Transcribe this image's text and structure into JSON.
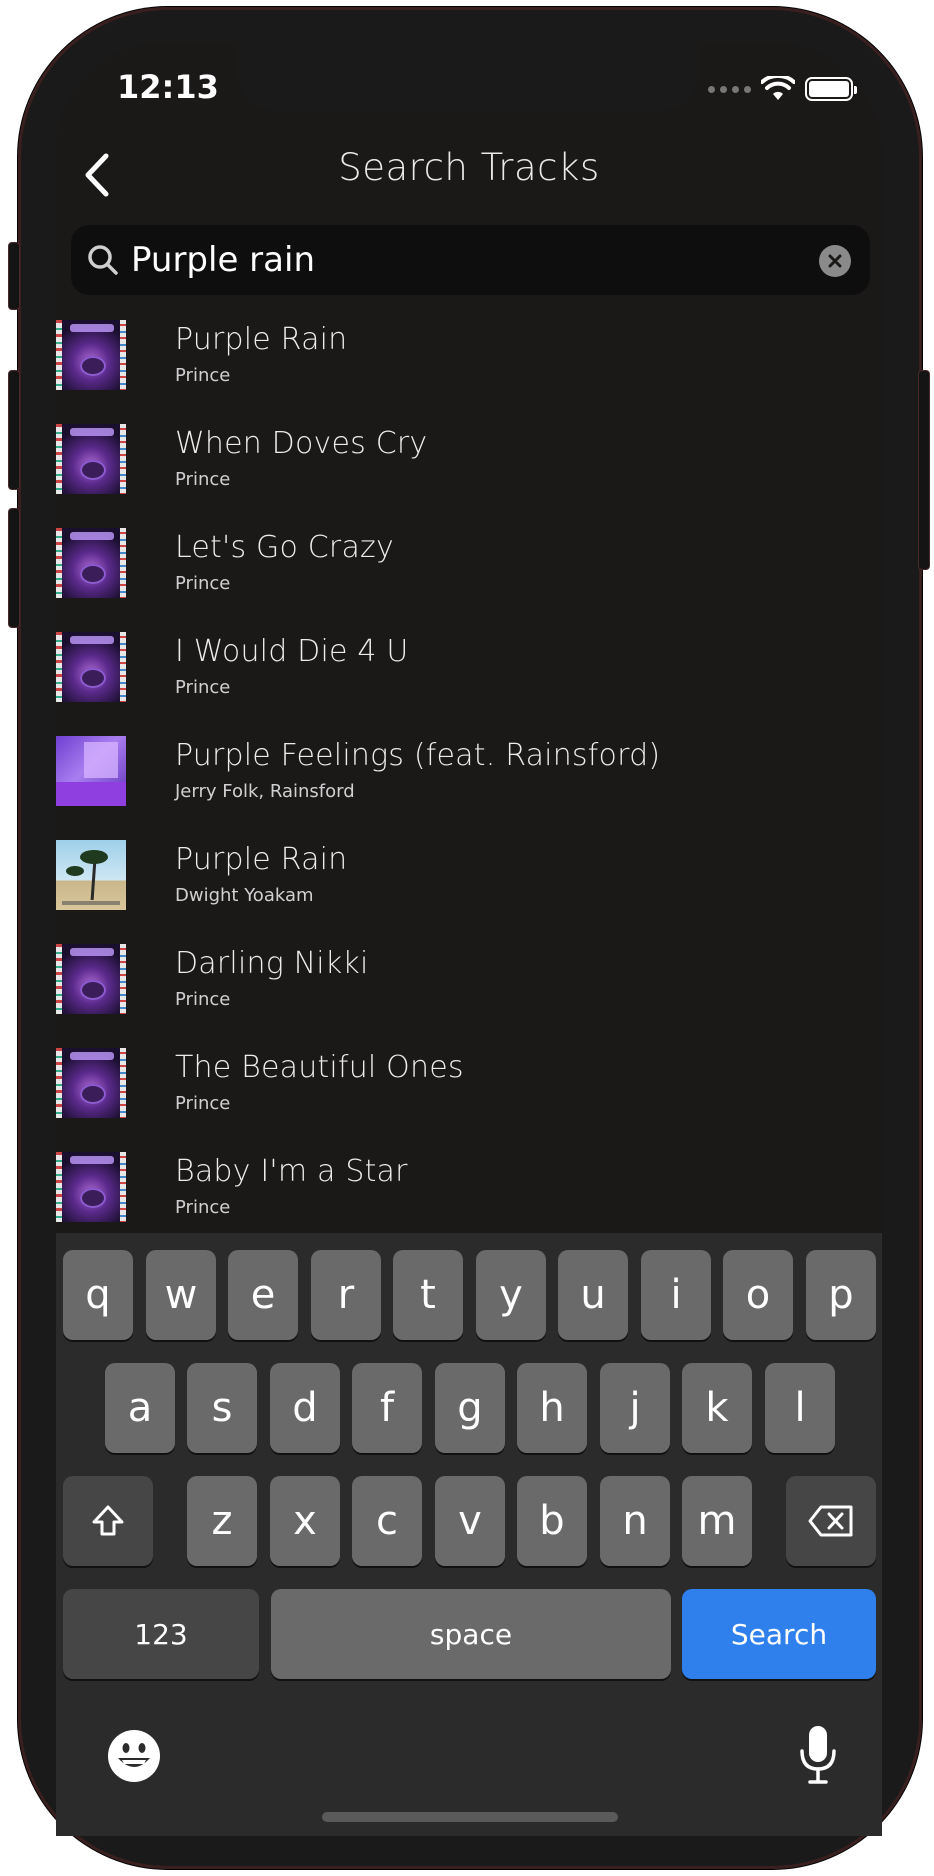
{
  "status_bar": {
    "time": "12:13"
  },
  "header": {
    "title": "Search Tracks"
  },
  "search": {
    "value": "Purple rain"
  },
  "tracks": [
    {
      "title": "Purple Rain",
      "artist": "Prince",
      "cover": "prince"
    },
    {
      "title": "When Doves Cry",
      "artist": "Prince",
      "cover": "prince"
    },
    {
      "title": "Let's Go Crazy",
      "artist": "Prince",
      "cover": "prince"
    },
    {
      "title": "I Would Die 4 U",
      "artist": "Prince",
      "cover": "prince"
    },
    {
      "title": "Purple Feelings (feat. Rainsford)",
      "artist": "Jerry Folk, Rainsford",
      "cover": "folk"
    },
    {
      "title": "Purple Rain",
      "artist": "Dwight Yoakam",
      "cover": "dwight"
    },
    {
      "title": "Darling Nikki",
      "artist": "Prince",
      "cover": "prince"
    },
    {
      "title": "The Beautiful Ones",
      "artist": "Prince",
      "cover": "prince"
    },
    {
      "title": "Baby I'm a Star",
      "artist": "Prince",
      "cover": "prince"
    }
  ],
  "keyboard": {
    "row1": [
      "q",
      "w",
      "e",
      "r",
      "t",
      "y",
      "u",
      "i",
      "o",
      "p"
    ],
    "row2": [
      "a",
      "s",
      "d",
      "f",
      "g",
      "h",
      "j",
      "k",
      "l"
    ],
    "row3": [
      "z",
      "x",
      "c",
      "v",
      "b",
      "n",
      "m"
    ],
    "numbers_label": "123",
    "space_label": "space",
    "search_label": "Search",
    "shift_icon": "shift-icon",
    "delete_icon": "backspace-icon",
    "emoji_icon": "emoji-icon",
    "mic_icon": "microphone-icon",
    "accent_color": "#2f80ed"
  }
}
